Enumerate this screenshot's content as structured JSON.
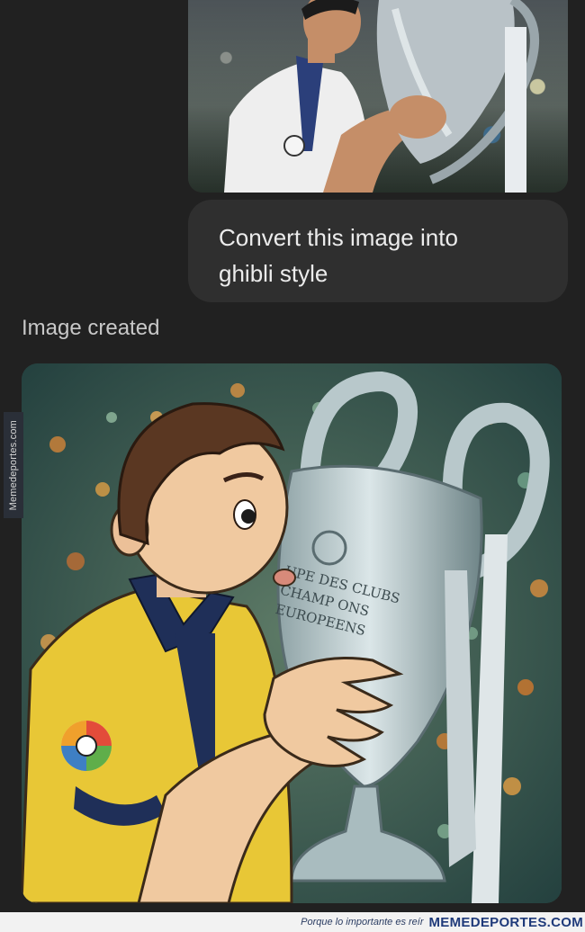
{
  "conversation": {
    "user_message": "Convert this image into ghibli style",
    "status_label": "Image created"
  },
  "generated_image": {
    "trophy_inscription": [
      "UPE DES CLUBS",
      "CHAMP ONS",
      "EUROPEENS"
    ]
  },
  "watermarks": {
    "side": "Memedeportes.com",
    "footer_tagline": "Porque lo importante es reír",
    "footer_brand": "MEMEDEPORTES.COM"
  },
  "colors": {
    "background": "#212121",
    "bubble": "#2f2f2f",
    "jersey": "#e8c736",
    "collar": "#1f2f58",
    "brand": "#1f3a7a"
  }
}
